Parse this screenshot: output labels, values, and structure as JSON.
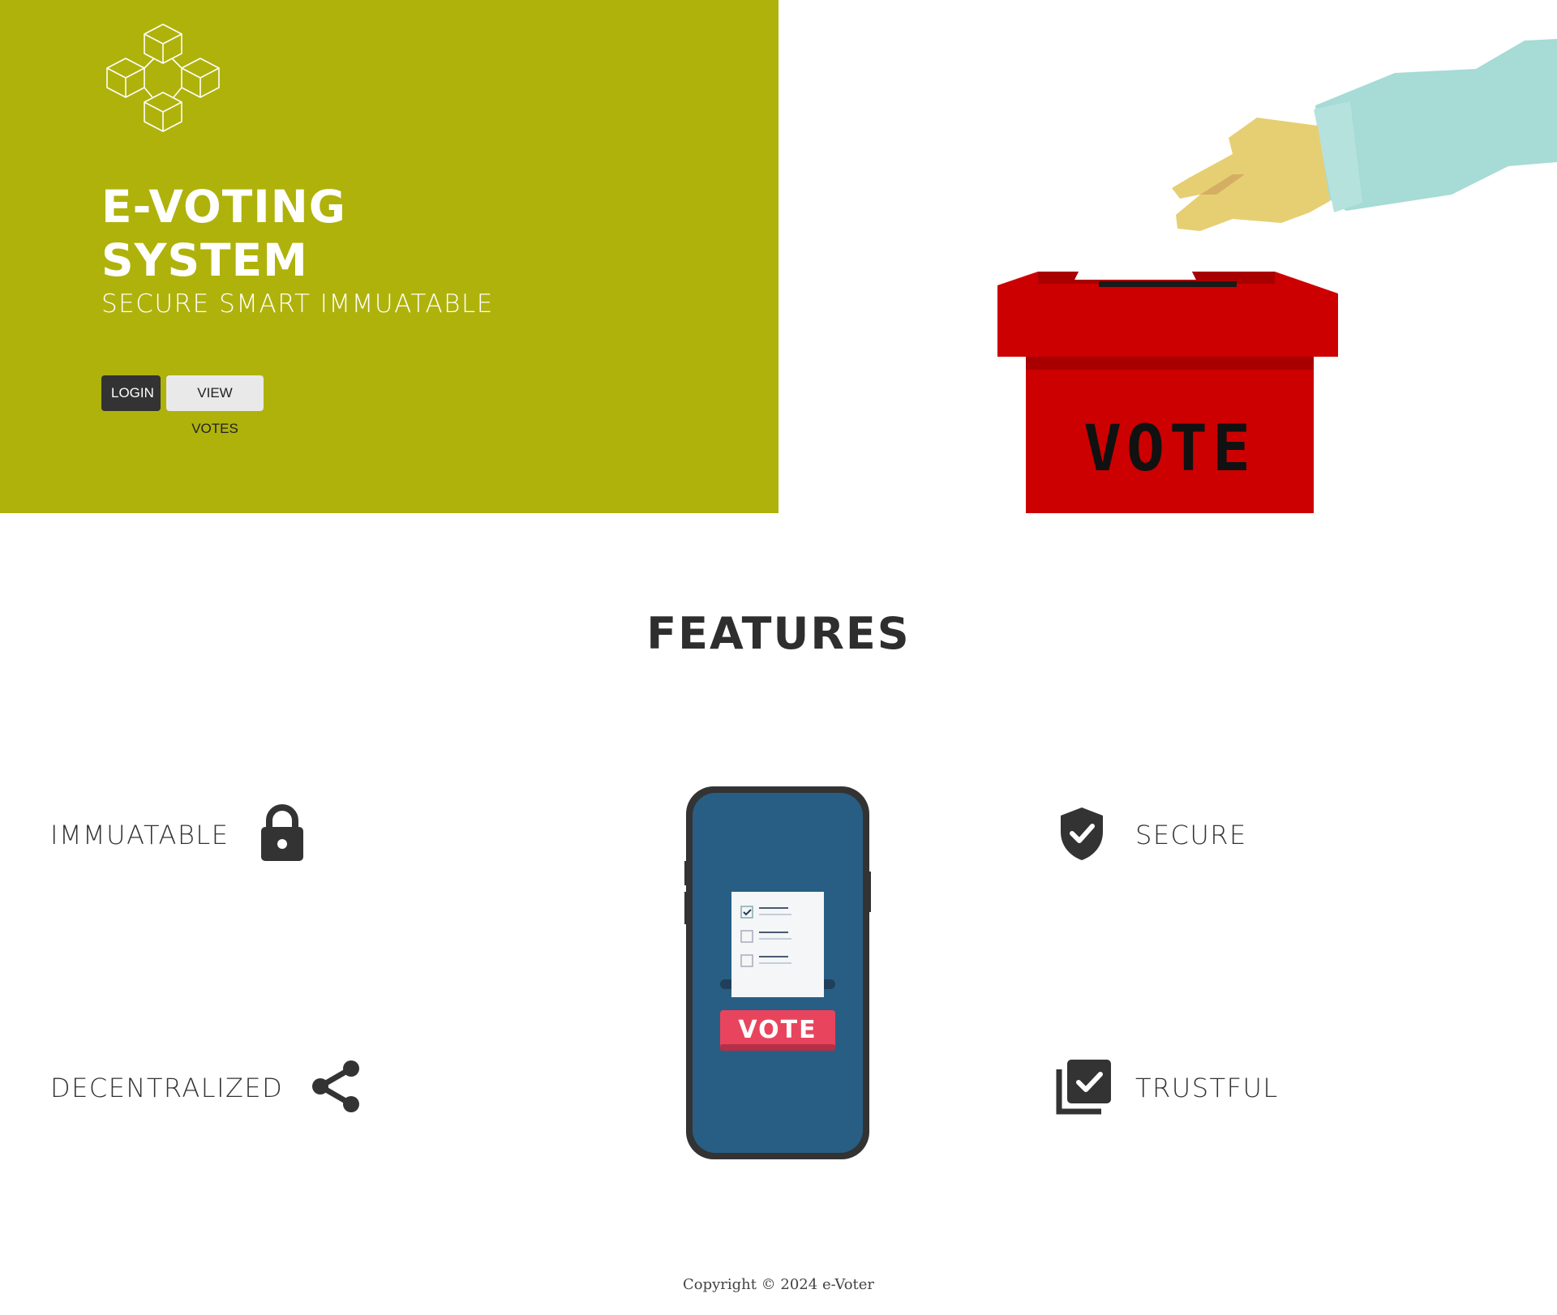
{
  "hero": {
    "title_line1": "E-VOTING",
    "title_line2": "SYSTEM",
    "tagline": "SECURE SMART IMMUATABLE",
    "login_label": "LOGIN",
    "view_votes_label": "VIEW VOTES",
    "background_color": "#afb20b",
    "logo_icon": "blockchain-cubes-icon",
    "illustration_text": "VOTE"
  },
  "features": {
    "title": "FEATURES",
    "items": [
      {
        "label": "IMMUATABLE",
        "icon": "lock-icon"
      },
      {
        "label": "DECENTRALIZED",
        "icon": "share-icon"
      },
      {
        "label": "SECURE",
        "icon": "shield-check-icon"
      },
      {
        "label": "TRUSTFUL",
        "icon": "checklist-icon"
      }
    ],
    "phone_button_text": "VOTE"
  },
  "footer": {
    "copyright": "Copyright © 2024 e-Voter"
  }
}
